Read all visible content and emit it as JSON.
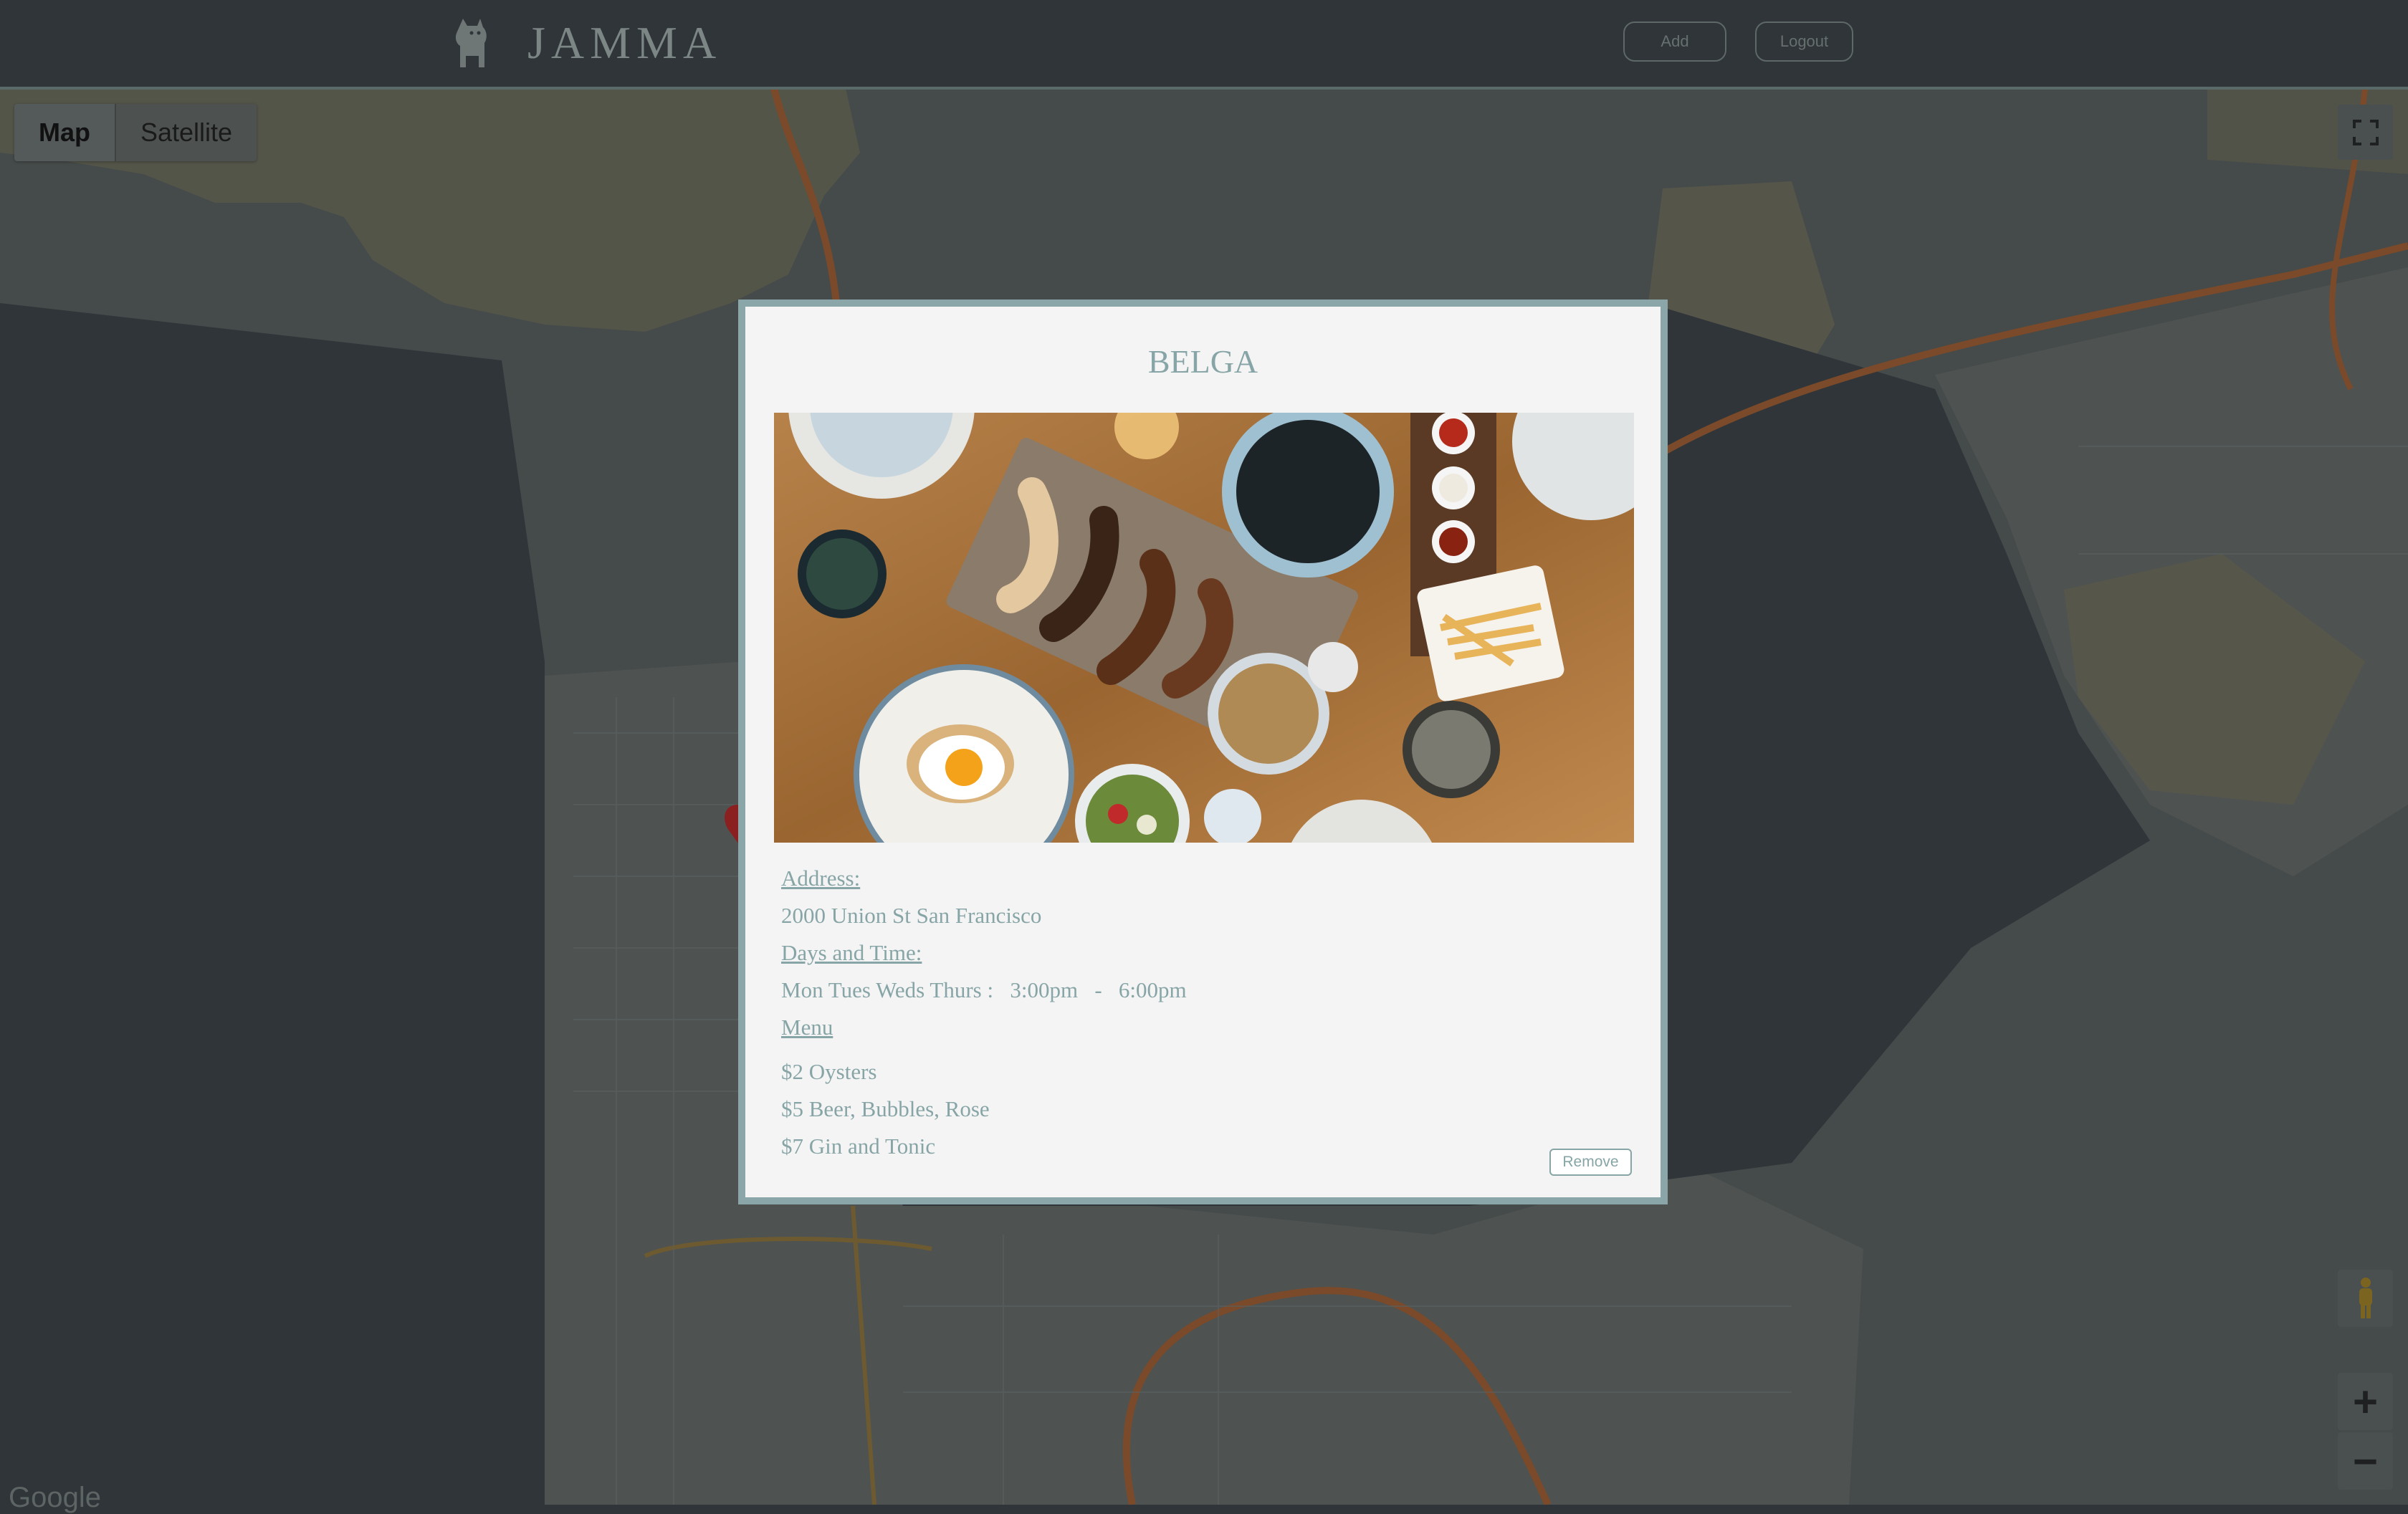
{
  "header": {
    "brand": "JAMMA",
    "add_label": "Add",
    "logout_label": "Logout"
  },
  "map": {
    "map_type_options": [
      "Map",
      "Satellite"
    ],
    "selected_map_type": "Map",
    "attribution": "Google",
    "zoom_in": "+",
    "zoom_out": "−"
  },
  "modal": {
    "title": "BELGA",
    "address_label": "Address:",
    "address": "2000 Union St San Francisco",
    "days_label": "Days and Time:",
    "days": "Mon Tues Weds Thurs :   3:00pm   -   6:00pm",
    "menu_label": "Menu",
    "menu_items": [
      "$2 Oysters",
      "$5 Beer, Bubbles, Rose",
      "$7 Gin and Tonic"
    ],
    "remove_label": "Remove"
  }
}
